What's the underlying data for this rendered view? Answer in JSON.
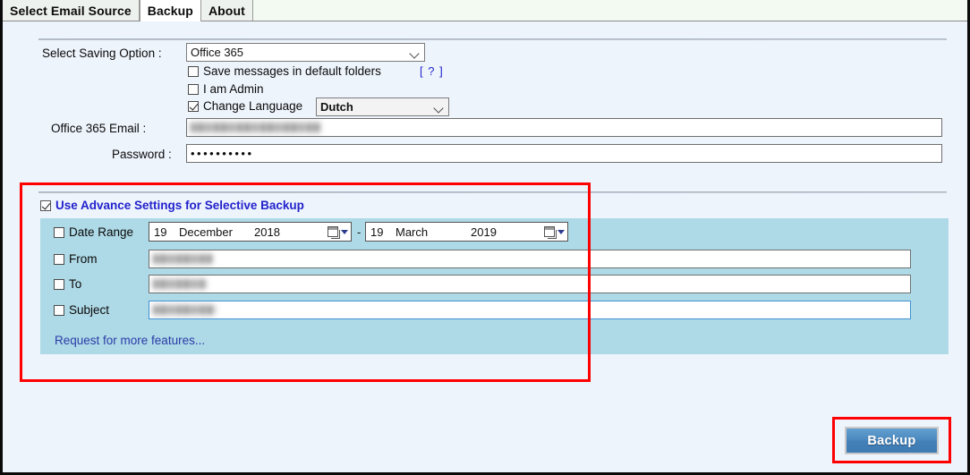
{
  "window": {
    "background_color": "#eef4fc"
  },
  "tabs": [
    {
      "label": "Select Email Source",
      "active": false
    },
    {
      "label": "Backup",
      "active": true
    },
    {
      "label": "About",
      "active": false
    }
  ],
  "form": {
    "saving_option": {
      "label": "Select Saving Option  :",
      "value": "Office 365"
    },
    "save_default_folders": {
      "label": "Save messages in default folders",
      "checked": false,
      "help": "[ ? ]"
    },
    "i_am_admin": {
      "label": "I am Admin",
      "checked": false
    },
    "change_language": {
      "label": "Change Language",
      "checked": true,
      "value": "Dutch"
    },
    "email": {
      "label": "Office 365 Email      :",
      "value": "",
      "redacted": true
    },
    "password": {
      "label": "Password :",
      "value": "••••••••••"
    }
  },
  "advanced": {
    "header": "Use Advance Settings for Selective Backup",
    "header_checked": true,
    "date_range": {
      "label": "Date Range",
      "checked": false,
      "separator": "-",
      "from": {
        "day": "19",
        "month": "December",
        "year": "2018"
      },
      "to": {
        "day": "19",
        "month": "March",
        "year": "2019"
      }
    },
    "from": {
      "label": "From",
      "checked": false,
      "value": "",
      "redacted": true
    },
    "to": {
      "label": "To",
      "checked": false,
      "value": "",
      "redacted": true
    },
    "subject": {
      "label": "Subject",
      "checked": false,
      "value": "",
      "redacted": true,
      "focused": true
    },
    "request_link": "Request for more features...",
    "panel_color": "#aed9e6"
  },
  "footer": {
    "backup_button": "Backup",
    "button_color": "#4a87be"
  },
  "annotations": {
    "highlight_color": "#ff0000"
  }
}
